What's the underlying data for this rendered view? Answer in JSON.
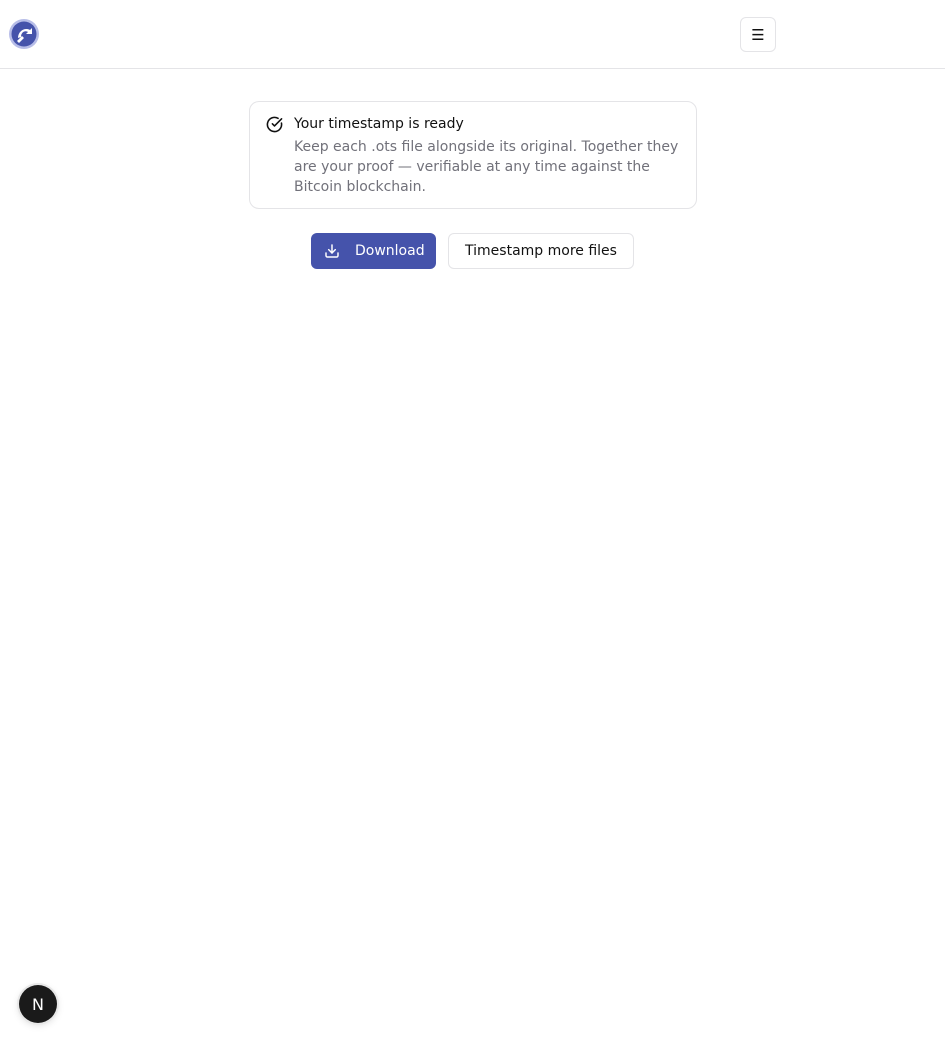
{
  "header": {
    "logo_icon": "logo-icon",
    "menu_glyph": "☰",
    "menu_icon": "hamburger-menu-icon"
  },
  "notice": {
    "icon": "check-circle-icon",
    "title": "Your timestamp is ready",
    "description": "Keep each .ots file alongside its original. Together they are your proof — verifiable at any time against the Bitcoin blockchain."
  },
  "actions": {
    "download_label": "Download",
    "download_icon": "download-icon",
    "more_label": "Timestamp more files"
  },
  "dev_badge": {
    "letter": "N"
  },
  "colors": {
    "accent": "#4553ab",
    "border": "#e4e4e7",
    "muted_text": "#71717a"
  }
}
